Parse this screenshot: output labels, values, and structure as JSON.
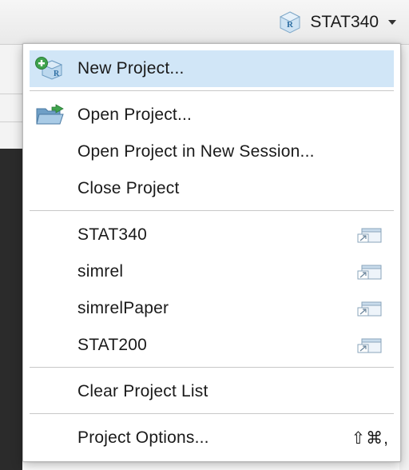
{
  "header": {
    "current_project": "STAT340",
    "icons": {
      "project": "r-project-cube-icon",
      "caret": "caret-down-icon"
    }
  },
  "menu": {
    "new_project": "New Project...",
    "open_project": "Open Project...",
    "open_new_session": "Open Project in New Session...",
    "close_project": "Close Project",
    "recent_projects": [
      "STAT340",
      "simrel",
      "simrelPaper",
      "STAT200"
    ],
    "clear_list": "Clear Project List",
    "project_options": "Project Options...",
    "project_options_shortcut": "⇧⌘,",
    "icons": {
      "new_project": "new-project-icon",
      "open_project": "open-folder-icon",
      "recent": "open-in-new-window-icon"
    },
    "highlighted_item": "New Project..."
  },
  "colors": {
    "highlight": "#d1e6f7",
    "menu_bg": "#ffffff",
    "separator": "#c8c8c8"
  }
}
